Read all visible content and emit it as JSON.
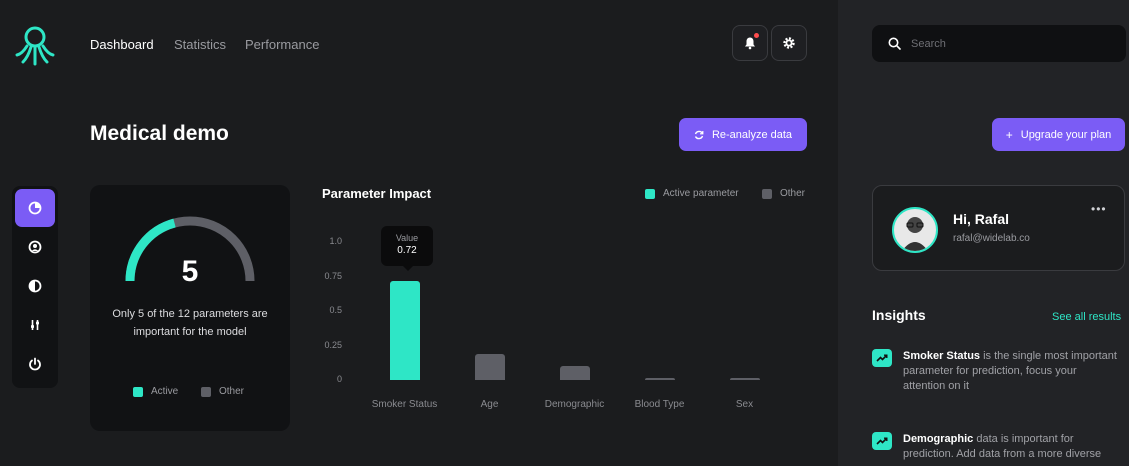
{
  "nav": {
    "items": [
      {
        "label": "Dashboard",
        "active": true
      },
      {
        "label": "Statistics",
        "active": false
      },
      {
        "label": "Performance",
        "active": false
      }
    ]
  },
  "search": {
    "placeholder": "Search"
  },
  "page": {
    "title": "Medical demo"
  },
  "buttons": {
    "reanalyze": "Re-analyze data",
    "upgrade": "Upgrade your plan"
  },
  "sidebar": {
    "icons": [
      "pie-chart-icon",
      "user-circle-icon",
      "contrast-icon",
      "sliders-icon",
      "power-icon"
    ]
  },
  "gauge": {
    "value": "5",
    "fraction": 0.4167,
    "description": "Only 5 of the 12 parameters are important for the model",
    "legend_active": "Active",
    "legend_other": "Other"
  },
  "chart_data": {
    "type": "bar",
    "title": "Parameter Impact",
    "categories": [
      "Smoker Status",
      "Age",
      "Demographic",
      "Blood Type",
      "Sex"
    ],
    "values": [
      0.72,
      0.19,
      0.1,
      0.01,
      0.01
    ],
    "active": [
      true,
      false,
      false,
      false,
      false
    ],
    "ylim": [
      0,
      1.0
    ],
    "yticks": [
      "1.0",
      "0.75",
      "0.5",
      "0.25",
      "0"
    ],
    "legend": {
      "active": "Active parameter",
      "other": "Other"
    },
    "tooltip": {
      "label": "Value",
      "value": "0.72"
    }
  },
  "profile": {
    "greeting": "Hi, Rafal",
    "email": "rafal@widelab.co"
  },
  "insights": {
    "title": "Insights",
    "see_all": "See all results",
    "items": [
      {
        "strong": "Smoker Status",
        "text": " is the single most important parameter for prediction, focus your attention on it"
      },
      {
        "strong": "Demographic",
        "text": " data is important for prediction. Add data from a more diverse"
      }
    ]
  },
  "colors": {
    "accent": "#2ee6c6",
    "purple": "#7b5cf5",
    "other": "#5e5f66"
  }
}
